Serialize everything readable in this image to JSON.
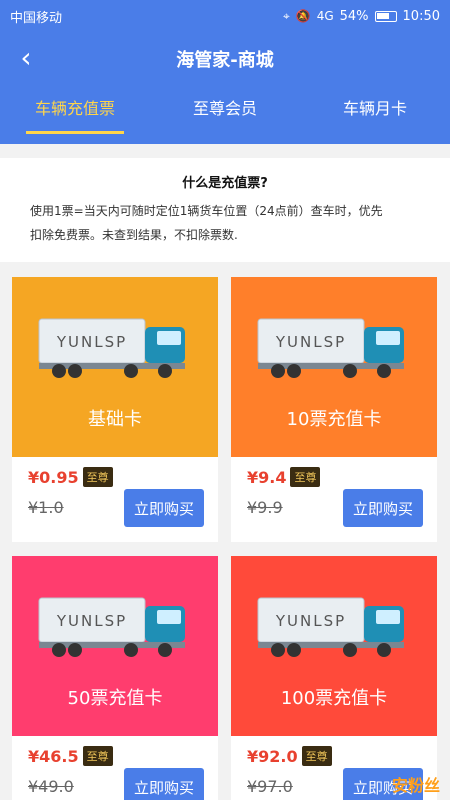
{
  "status": {
    "carrier": "中国移动",
    "signal": "4G",
    "battery": "54%",
    "time": "10:50"
  },
  "header": {
    "title": "海管家-商城",
    "back_icon": "chevron-left-icon"
  },
  "tabs": [
    {
      "label": "车辆充值票",
      "active": true
    },
    {
      "label": "至尊会员",
      "active": false
    },
    {
      "label": "车辆月卡",
      "active": false
    }
  ],
  "info": {
    "title": "什么是充值票?",
    "line1": "使用1票=当天内可随时定位1辆货车位置（24点前）查车时，优先",
    "line2": "扣除免费票。未查到结果，不扣除票数."
  },
  "cards": [
    {
      "name": "基础卡",
      "price": "¥0.95",
      "badge": "至尊",
      "original": "¥1.0",
      "button": "立即购买",
      "bg": "#f5a623",
      "truck_label": "YUNLSP"
    },
    {
      "name": "10票充值卡",
      "price": "¥9.4",
      "badge": "至尊",
      "original": "¥9.9",
      "button": "立即购买",
      "bg": "#ff7f2a",
      "truck_label": "YUNLSP"
    },
    {
      "name": "50票充值卡",
      "price": "¥46.5",
      "badge": "至尊",
      "original": "¥49.0",
      "button": "立即购买",
      "bg": "#ff3d6e",
      "truck_label": "YUNLSP"
    },
    {
      "name": "100票充值卡",
      "price": "¥92.0",
      "badge": "至尊",
      "original": "¥97.0",
      "button": "立即购买",
      "bg": "#ff4a3a",
      "truck_label": "YUNLSP"
    }
  ],
  "watermark": "安粉丝"
}
